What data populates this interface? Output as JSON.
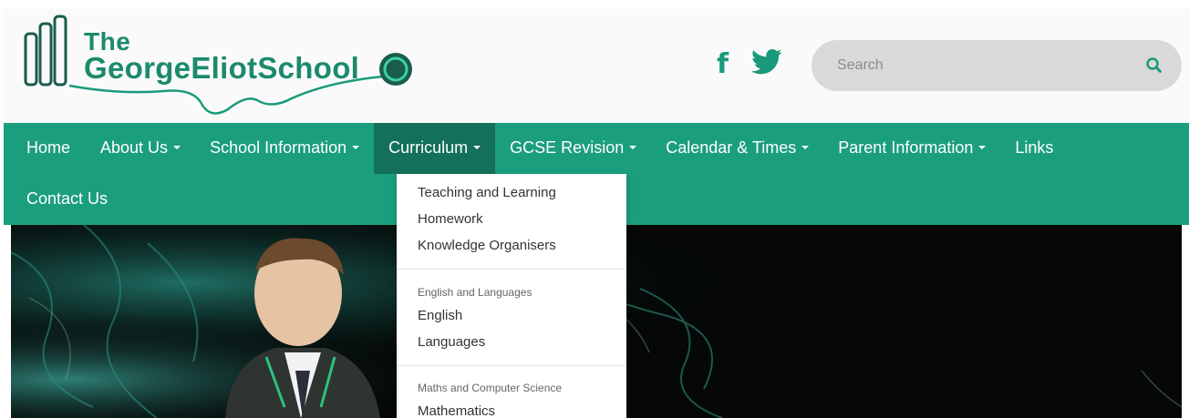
{
  "header": {
    "logo": {
      "line1": "The",
      "line2": "GeorgeEliotSchool"
    },
    "social": [
      {
        "name": "facebook-icon",
        "glyph": "f"
      },
      {
        "name": "twitter-icon"
      }
    ],
    "search": {
      "placeholder": "Search",
      "value": ""
    }
  },
  "nav": {
    "row1": [
      {
        "label": "Home",
        "dropdown": false
      },
      {
        "label": "About Us",
        "dropdown": true
      },
      {
        "label": "School Information",
        "dropdown": true
      },
      {
        "label": "Curriculum",
        "dropdown": true,
        "active": true
      },
      {
        "label": "GCSE Revision",
        "dropdown": true
      },
      {
        "label": "Calendar & Times",
        "dropdown": true
      },
      {
        "label": "Parent Information",
        "dropdown": true
      },
      {
        "label": "Links",
        "dropdown": false
      }
    ],
    "row2": [
      {
        "label": "Contact Us",
        "dropdown": false
      }
    ]
  },
  "dropdown": {
    "items": [
      {
        "type": "link",
        "label": "Teaching and Learning"
      },
      {
        "type": "link",
        "label": "Homework"
      },
      {
        "type": "link",
        "label": "Knowledge Organisers"
      },
      {
        "type": "divider"
      },
      {
        "type": "header",
        "label": "English and Languages"
      },
      {
        "type": "link",
        "label": "English"
      },
      {
        "type": "link",
        "label": "Languages"
      },
      {
        "type": "divider"
      },
      {
        "type": "header",
        "label": "Maths and Computer Science"
      },
      {
        "type": "link",
        "label": "Mathematics"
      }
    ]
  },
  "colors": {
    "brand_green": "#1b9e7e",
    "nav_active": "#13705a",
    "logo_green": "#1b8a6b",
    "search_bg": "#d9d9d9"
  }
}
